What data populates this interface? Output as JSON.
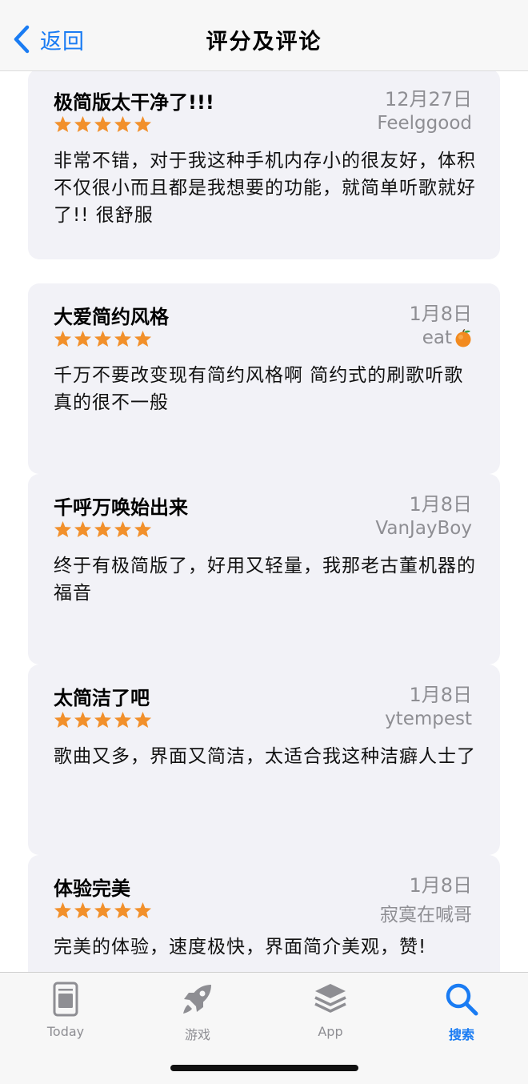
{
  "nav": {
    "back_label": "返回",
    "title": "评分及评论"
  },
  "colors": {
    "accent": "#1a7cf3",
    "star": "#f2902b",
    "card_bg": "#f2f2f7",
    "secondary_text": "#8e8e93"
  },
  "reviews": [
    {
      "title": "极简版太干净了!!!",
      "date": "12月27日",
      "author": "Feelggood",
      "rating": 5,
      "body": "非常不错，对于我这种手机内存小的很友好，体积不仅很小而且都是我想要的功能，就简单听歌就好了!! 很舒服"
    },
    {
      "title": "大爱简约风格",
      "date": "1月8日",
      "author": "eat",
      "author_emoji": "orange-emoji",
      "rating": 5,
      "body": "千万不要改变现有简约风格啊 简约式的刷歌听歌真的很不一般"
    },
    {
      "title": "千呼万唤始出来",
      "date": "1月8日",
      "author": "VanJayBoy",
      "rating": 5,
      "body": "终于有极简版了，好用又轻量，我那老古董机器的福音"
    },
    {
      "title": "太简洁了吧",
      "date": "1月8日",
      "author": "ytempest",
      "rating": 5,
      "body": "歌曲又多，界面又简洁，太适合我这种洁癖人士了"
    },
    {
      "title": "体验完美",
      "date": "1月8日",
      "author": "寂寞在喊哥",
      "rating": 5,
      "body": "完美的体验，速度极快，界面简介美观，赞!"
    }
  ],
  "tabs": [
    {
      "label": "Today",
      "icon": "today-icon",
      "active": false
    },
    {
      "label": "游戏",
      "icon": "rocket-icon",
      "active": false
    },
    {
      "label": "App",
      "icon": "app-stack-icon",
      "active": false
    },
    {
      "label": "搜索",
      "icon": "search-icon",
      "active": true
    }
  ]
}
